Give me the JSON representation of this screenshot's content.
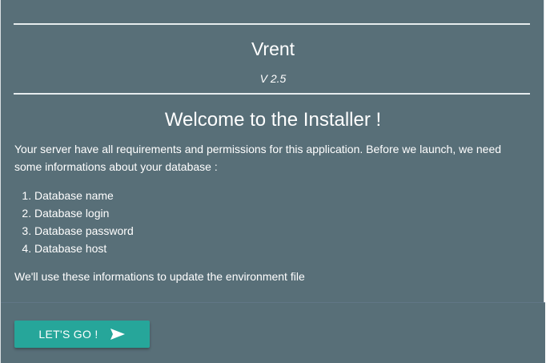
{
  "header": {
    "app_name": "Vrent",
    "version": "V 2.5"
  },
  "welcome": {
    "title": "Welcome to the Installer !",
    "intro": "Your server have all requirements and permissions for this application. Before we launch, we need some informations about your database :",
    "requirements": [
      "Database name",
      "Database login",
      "Database password",
      "Database host"
    ],
    "outro": "We'll use these informations to update the environment file"
  },
  "footer": {
    "button_label": "LET'S GO !",
    "button_icon": "send-arrow-icon"
  },
  "colors": {
    "panel_background": "#586f78",
    "button_background": "#26a69a",
    "text": "#ffffff"
  }
}
